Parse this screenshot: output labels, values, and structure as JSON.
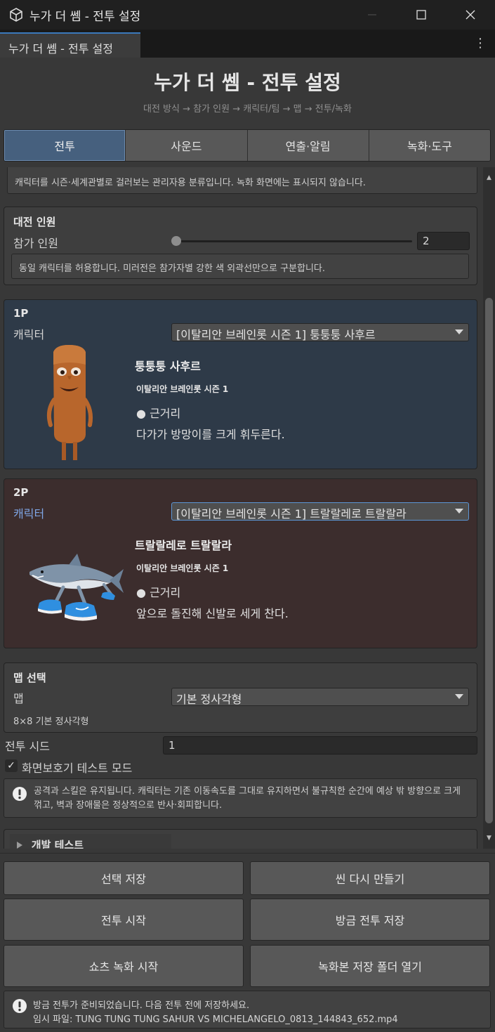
{
  "window": {
    "title": "누가 더 쎔 - 전투 설정"
  },
  "doc_tab": {
    "label": "누가 더 쎔 - 전투 설정"
  },
  "header": {
    "title": "누가 더 쎔 - 전투 설정",
    "steps": "대전 방식 → 참가 인원 → 캐릭터/팀 → 맵 → 전투/녹화"
  },
  "category_tabs": [
    {
      "label": "전투",
      "active": true
    },
    {
      "label": "사운드",
      "active": false
    },
    {
      "label": "연출·알림",
      "active": false
    },
    {
      "label": "녹화·도구",
      "active": false
    }
  ],
  "category_note": "캐릭터를 시즌·세계관별로 걸러보는 관리자용 분류입니다. 녹화 화면에는 표시되지 않습니다.",
  "participants": {
    "heading": "대전 인원",
    "label": "참가 인원",
    "value": "2",
    "slider_fraction": 0.0,
    "note": "동일 캐릭터를 허용합니다. 미러전은 참가자별 강한 색 외곽선만으로 구분합니다."
  },
  "player1": {
    "heading": "1P",
    "character_label": "캐릭터",
    "selected": "[이탈리안 브레인롯 시즌 1] 퉁퉁퉁 사후르",
    "name": "퉁퉁퉁 사후르",
    "series": "이탈리안 브레인롯 시즌 1",
    "range_bullet": "●",
    "range": "근거리",
    "description": "다가가 방망이를 크게 휘두른다.",
    "panel_color": "#2e3a48"
  },
  "player2": {
    "heading": "2P",
    "character_label": "캐릭터",
    "selected": "[이탈리안 브레인롯 시즌 1] 트랄랄레로 트랄랄라",
    "name": "트랄랄레로 트랄랄라",
    "series": "이탈리안 브레인롯 시즌 1",
    "range_bullet": "●",
    "range": "근거리",
    "description": "앞으로 돌진해 신발로 세게 찬다.",
    "panel_color": "#3c2d2d"
  },
  "map": {
    "heading": "맵 선택",
    "label": "맵",
    "selected": "기본 정사각형",
    "note": "8×8 기본 정사각형"
  },
  "seed": {
    "label": "전투 시드",
    "value": "1"
  },
  "screensaver": {
    "label": "화면보호기 테스트 모드",
    "checked": true,
    "note": "공격과 스킬은 유지됩니다. 캐릭터는 기존 이동속도를 그대로 유지하면서 불규칙한 순간에 예상 밖 방향으로 크게 꺾고, 벽과 장애물은 정상적으로 반사·회피합니다."
  },
  "dev_test": {
    "label": "개발 테스트"
  },
  "buttons": {
    "save_selection": "선택 저장",
    "rebuild_scene": "씬 다시 만들기",
    "start_battle": "전투 시작",
    "save_last_battle": "방금 전투 저장",
    "start_shorts_recording": "쇼츠 녹화 시작",
    "open_recording_folder": "녹화본 저장 폴더 열기"
  },
  "status": {
    "line1": "방금 전투가 준비되었습니다. 다음 전투 전에 저장하세요.",
    "line2": "임시 파일: TUNG TUNG TUNG SAHUR VS MICHELANGELO_0813_144843_652.mp4"
  },
  "colors": {
    "accent": "#46607e",
    "focus_label": "#7fa6e6",
    "focus_border": "#5c97d6"
  }
}
